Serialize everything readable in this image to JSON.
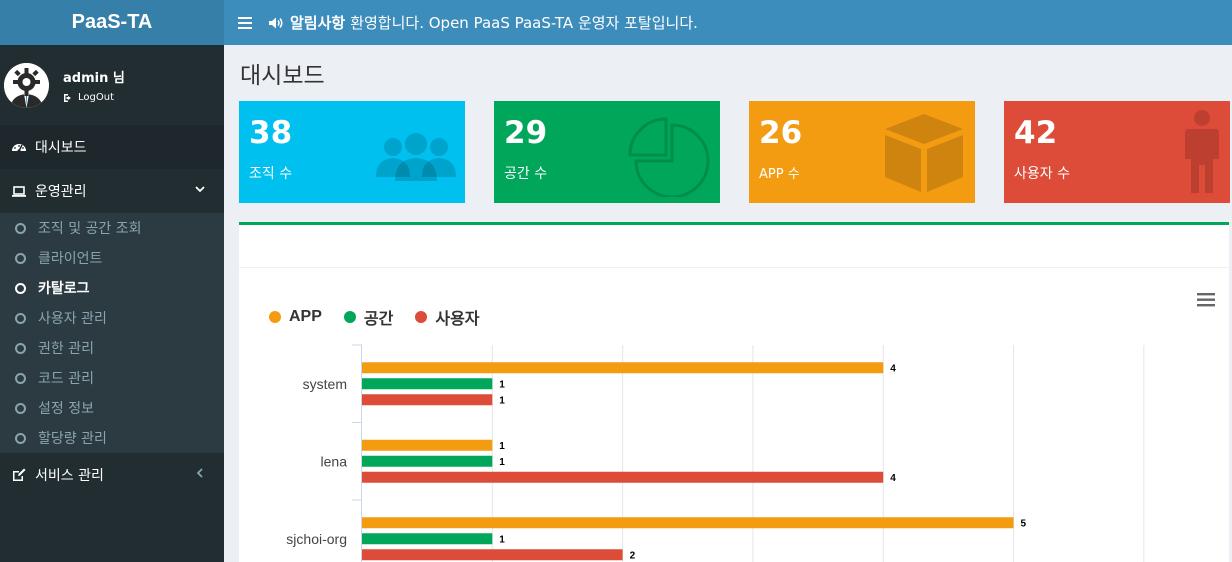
{
  "app": {
    "logo": "PaaS-TA"
  },
  "user": {
    "name": "admin 님",
    "logout": "LogOut"
  },
  "header": {
    "notice_label": "알림사항",
    "notice_text": "환영합니다. Open PaaS PaaS-TA 운영자 포탈입니다."
  },
  "sidebar": {
    "dashboard": "대시보드",
    "ops": "운영관리",
    "sub_items": [
      {
        "label": "조직 및 공간 조회",
        "active": false
      },
      {
        "label": "클라이언트",
        "active": false
      },
      {
        "label": "카탈로그",
        "active": true
      },
      {
        "label": "사용자 관리",
        "active": false
      },
      {
        "label": "권한 관리",
        "active": false
      },
      {
        "label": "코드 관리",
        "active": false
      },
      {
        "label": "설정 정보",
        "active": false
      },
      {
        "label": "할당량 관리",
        "active": false
      }
    ],
    "service": "서비스 관리"
  },
  "page": {
    "title": "대시보드"
  },
  "cards": [
    {
      "value": "38",
      "label": "조직 수",
      "color": "#00c0ef",
      "icon": "users-icon"
    },
    {
      "value": "29",
      "label": "공간 수",
      "color": "#00a65a",
      "icon": "pie-chart-icon"
    },
    {
      "value": "26",
      "label": "APP 수",
      "color": "#f39c12",
      "icon": "cube-icon"
    },
    {
      "value": "42",
      "label": "사용자 수",
      "color": "#dd4b39",
      "icon": "male-icon"
    }
  ],
  "chart_data": {
    "type": "bar",
    "orientation": "horizontal",
    "categories": [
      "system",
      "lena",
      "sjchoi-org"
    ],
    "series": [
      {
        "name": "APP",
        "color": "#f39c12",
        "values": [
          4,
          1,
          5
        ]
      },
      {
        "name": "공간",
        "color": "#00a65a",
        "values": [
          1,
          1,
          1
        ]
      },
      {
        "name": "사용자",
        "color": "#dd4b39",
        "values": [
          1,
          4,
          2
        ]
      }
    ],
    "xlim": [
      0,
      6.5
    ],
    "grid": true,
    "legend": "top-left"
  }
}
